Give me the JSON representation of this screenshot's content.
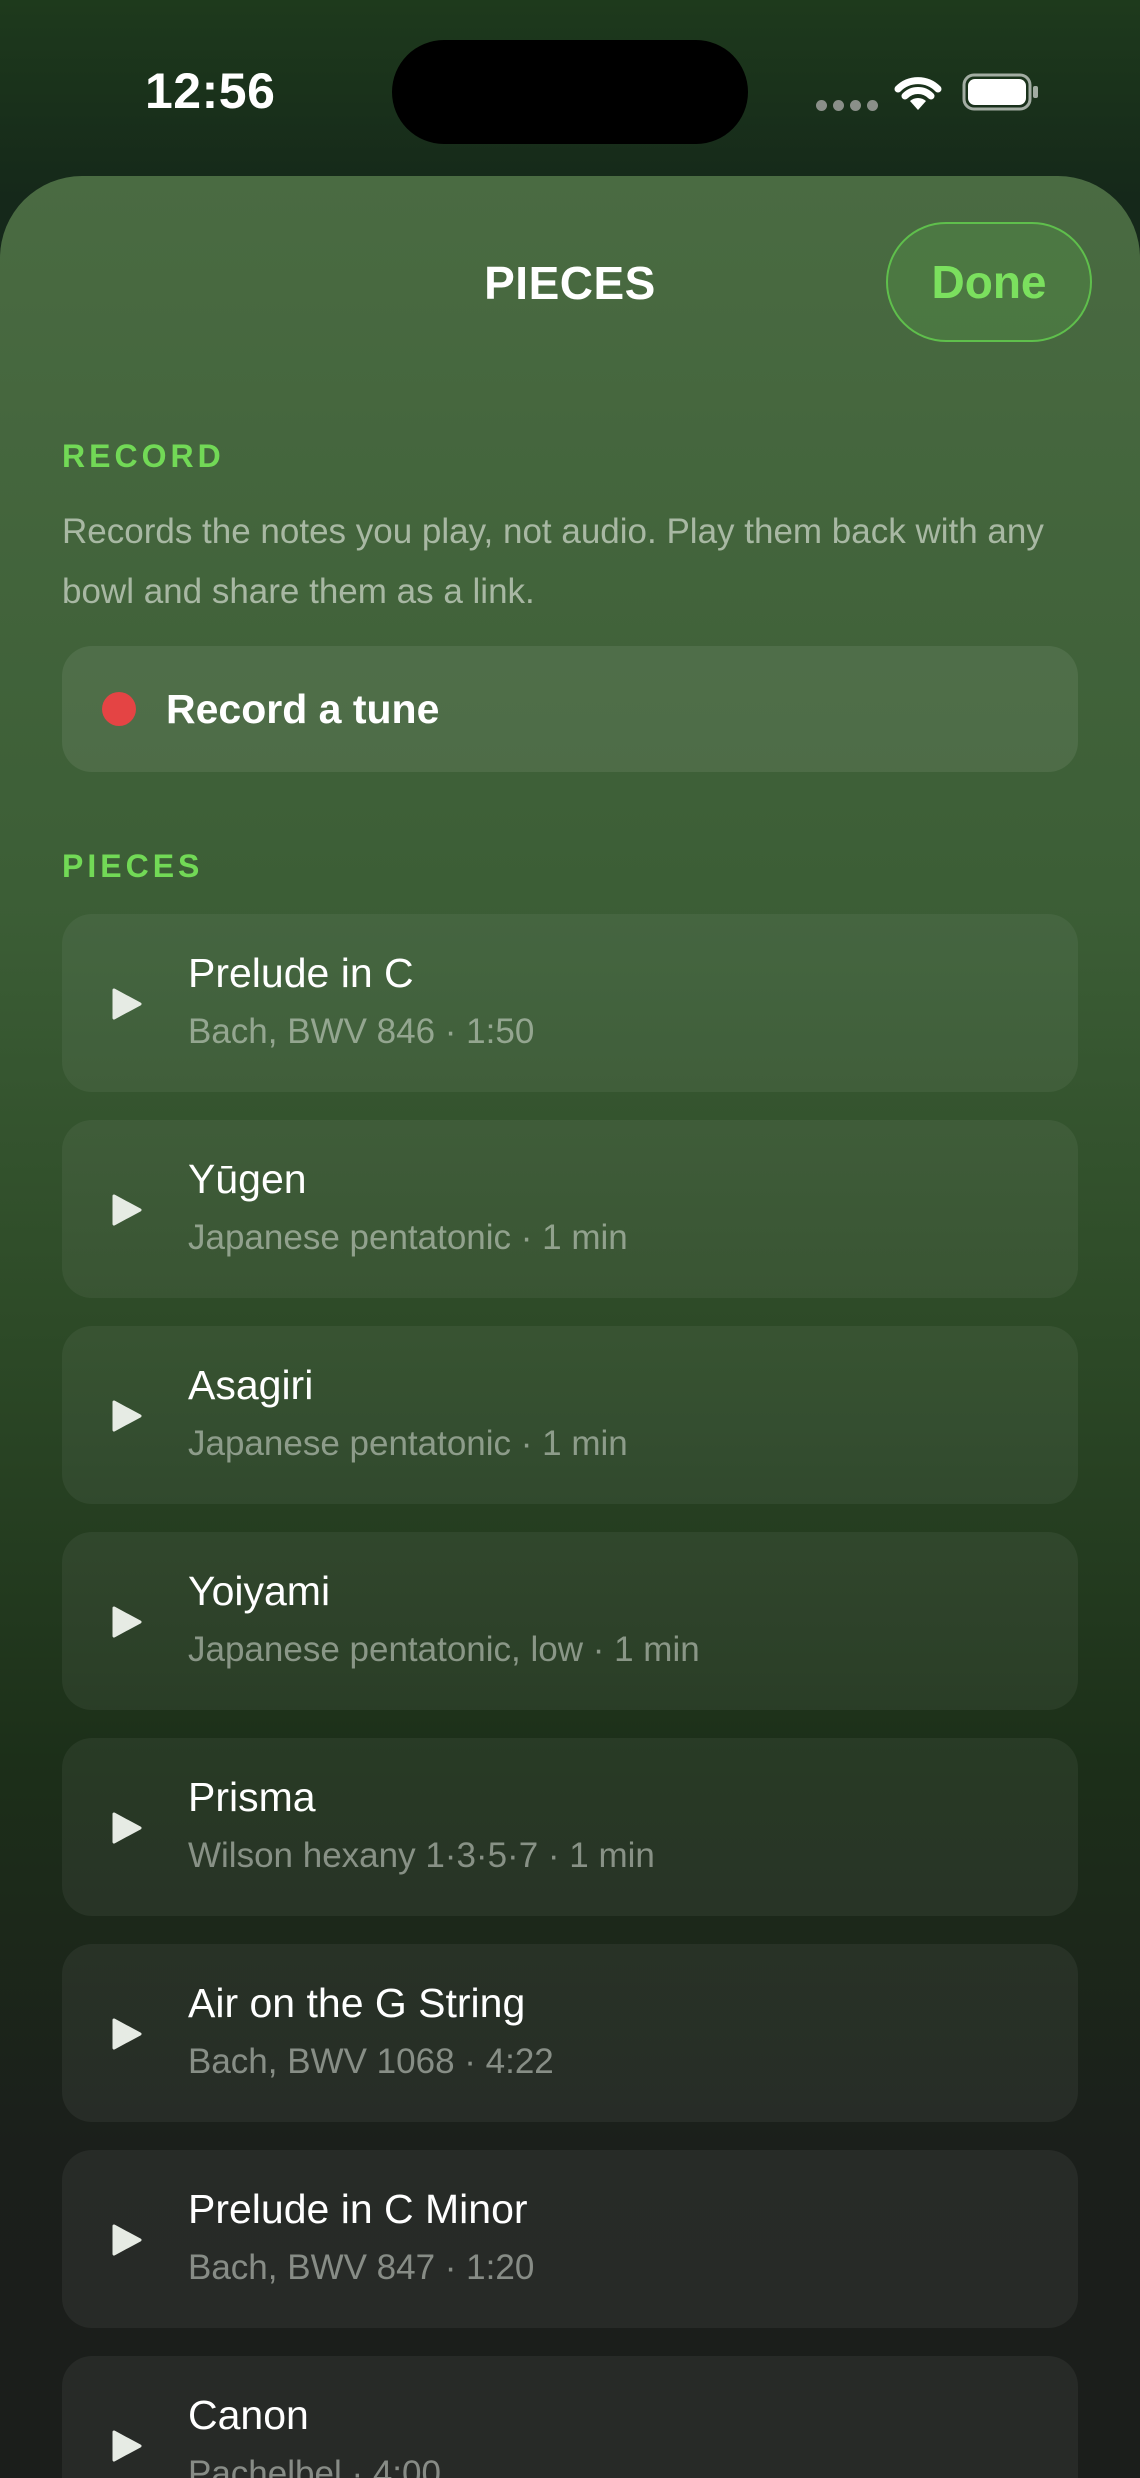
{
  "status_bar": {
    "time": "12:56"
  },
  "sheet": {
    "title": "PIECES",
    "done_label": "Done"
  },
  "record_section": {
    "header": "RECORD",
    "description": "Records the notes you play, not audio. Play them back with any bowl and share them as a link.",
    "record_button_label": "Record a tune",
    "record_dot_color": "#e44444"
  },
  "pieces_section": {
    "header": "PIECES",
    "items": [
      {
        "title": "Prelude in C",
        "subtitle": "Bach, BWV 846 · 1:50"
      },
      {
        "title": "Yūgen",
        "subtitle": "Japanese pentatonic · 1 min"
      },
      {
        "title": "Asagiri",
        "subtitle": "Japanese pentatonic · 1 min"
      },
      {
        "title": "Yoiyami",
        "subtitle": "Japanese pentatonic, low · 1 min"
      },
      {
        "title": "Prisma",
        "subtitle": "Wilson hexany 1·3·5·7 · 1 min"
      },
      {
        "title": "Air on the G String",
        "subtitle": "Bach, BWV 1068 · 4:22"
      },
      {
        "title": "Prelude in C Minor",
        "subtitle": "Bach, BWV 847 · 1:20"
      },
      {
        "title": "Canon",
        "subtitle": "Pachelbel · 4:00"
      }
    ]
  },
  "colors": {
    "accent": "#72d956",
    "done_text": "#7be05e"
  }
}
